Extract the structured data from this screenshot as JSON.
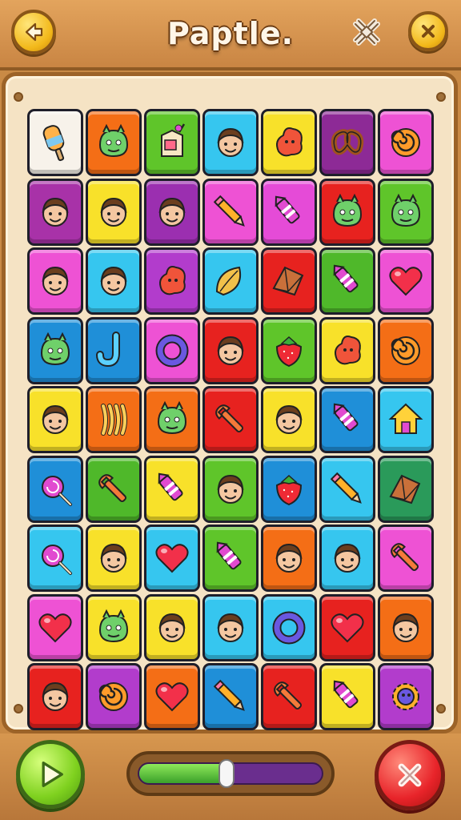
{
  "header": {
    "title": "Paptle.",
    "back_icon": "arrow-left-icon",
    "settings_icon": "knot-icon",
    "close_icon": "close-icon"
  },
  "board": {
    "rows": 9,
    "columns": 7,
    "tiles": [
      [
        {
          "color": "#f7f2ea",
          "icon": "popsicle-icon"
        },
        {
          "color": "#f46e16",
          "icon": "monster-head-icon"
        },
        {
          "color": "#5fc52a",
          "icon": "juice-box-icon"
        },
        {
          "color": "#36c6ef",
          "icon": "face-icon"
        },
        {
          "color": "#f8e12a",
          "icon": "blob-icon"
        },
        {
          "color": "#8d2a96",
          "icon": "pretzel-icon"
        },
        {
          "color": "#ee52d4",
          "icon": "swirl-icon"
        }
      ],
      [
        {
          "color": "#a832a8",
          "icon": "face-icon"
        },
        {
          "color": "#f8e12a",
          "icon": "face-icon"
        },
        {
          "color": "#9b2fb0",
          "icon": "face-icon"
        },
        {
          "color": "#ee52d4",
          "icon": "pencil-icon"
        },
        {
          "color": "#e54bd7",
          "icon": "crayon-icon"
        },
        {
          "color": "#e7221f",
          "icon": "monster-head-icon"
        },
        {
          "color": "#5fc52a",
          "icon": "monster-head-icon"
        }
      ],
      [
        {
          "color": "#ee52d4",
          "icon": "face-icon"
        },
        {
          "color": "#36c6ef",
          "icon": "face-icon"
        },
        {
          "color": "#b23ccc",
          "icon": "blob-icon"
        },
        {
          "color": "#36c6ef",
          "icon": "leaf-icon"
        },
        {
          "color": "#e7221f",
          "icon": "crystal-icon"
        },
        {
          "color": "#4fb82a",
          "icon": "crayon-icon"
        },
        {
          "color": "#ee52d4",
          "icon": "heart-icon"
        }
      ],
      [
        {
          "color": "#1f8fd8",
          "icon": "monster-head-icon"
        },
        {
          "color": "#1f8fd8",
          "icon": "hook-icon"
        },
        {
          "color": "#ee52d4",
          "icon": "ring-icon"
        },
        {
          "color": "#e7221f",
          "icon": "face-icon"
        },
        {
          "color": "#5fc52a",
          "icon": "strawberry-icon"
        },
        {
          "color": "#f8e12a",
          "icon": "blob-icon"
        },
        {
          "color": "#f46e16",
          "icon": "swirl-icon"
        }
      ],
      [
        {
          "color": "#f8e12a",
          "icon": "face-icon"
        },
        {
          "color": "#f46e16",
          "icon": "noodles-icon"
        },
        {
          "color": "#f46e16",
          "icon": "monster-head-icon"
        },
        {
          "color": "#e7221f",
          "icon": "wrench-icon"
        },
        {
          "color": "#f8e12a",
          "icon": "face-icon"
        },
        {
          "color": "#1f8fd8",
          "icon": "crayon-icon"
        },
        {
          "color": "#36c6ef",
          "icon": "house-icon"
        }
      ],
      [
        {
          "color": "#1f8fd8",
          "icon": "lollipop-icon"
        },
        {
          "color": "#4fb82a",
          "icon": "wrench-icon"
        },
        {
          "color": "#f8e12a",
          "icon": "crayon-icon"
        },
        {
          "color": "#5fc52a",
          "icon": "face-icon"
        },
        {
          "color": "#1f8fd8",
          "icon": "strawberry-icon"
        },
        {
          "color": "#36c6ef",
          "icon": "pencil-icon"
        },
        {
          "color": "#2a9a5a",
          "icon": "crystal-icon"
        }
      ],
      [
        {
          "color": "#36c6ef",
          "icon": "lollipop-icon"
        },
        {
          "color": "#f8e12a",
          "icon": "face-icon"
        },
        {
          "color": "#36c6ef",
          "icon": "heart-icon"
        },
        {
          "color": "#5fc52a",
          "icon": "crayon-icon"
        },
        {
          "color": "#f46e16",
          "icon": "face-icon"
        },
        {
          "color": "#36c6ef",
          "icon": "face-icon"
        },
        {
          "color": "#ee52d4",
          "icon": "wrench-icon"
        }
      ],
      [
        {
          "color": "#ee52d4",
          "icon": "heart-icon"
        },
        {
          "color": "#f8e12a",
          "icon": "monster-head-icon"
        },
        {
          "color": "#f8e12a",
          "icon": "face-icon"
        },
        {
          "color": "#36c6ef",
          "icon": "face-icon"
        },
        {
          "color": "#36c6ef",
          "icon": "ring-icon"
        },
        {
          "color": "#e7221f",
          "icon": "heart-icon"
        },
        {
          "color": "#f46e16",
          "icon": "face-icon"
        }
      ],
      [
        {
          "color": "#e7221f",
          "icon": "face-icon"
        },
        {
          "color": "#b23ccc",
          "icon": "swirl-icon"
        },
        {
          "color": "#f46e16",
          "icon": "heart-icon"
        },
        {
          "color": "#1f8fd8",
          "icon": "pencil-icon"
        },
        {
          "color": "#e7221f",
          "icon": "wrench-icon"
        },
        {
          "color": "#f8e12a",
          "icon": "crayon-icon"
        },
        {
          "color": "#b23ccc",
          "icon": "gear-icon"
        }
      ]
    ]
  },
  "footer": {
    "play_icon": "play-icon",
    "close_icon": "close-icon",
    "progress_percent": 48,
    "progress_fill_color": "#5cc23a",
    "progress_empty_color": "#6a2e8e"
  }
}
